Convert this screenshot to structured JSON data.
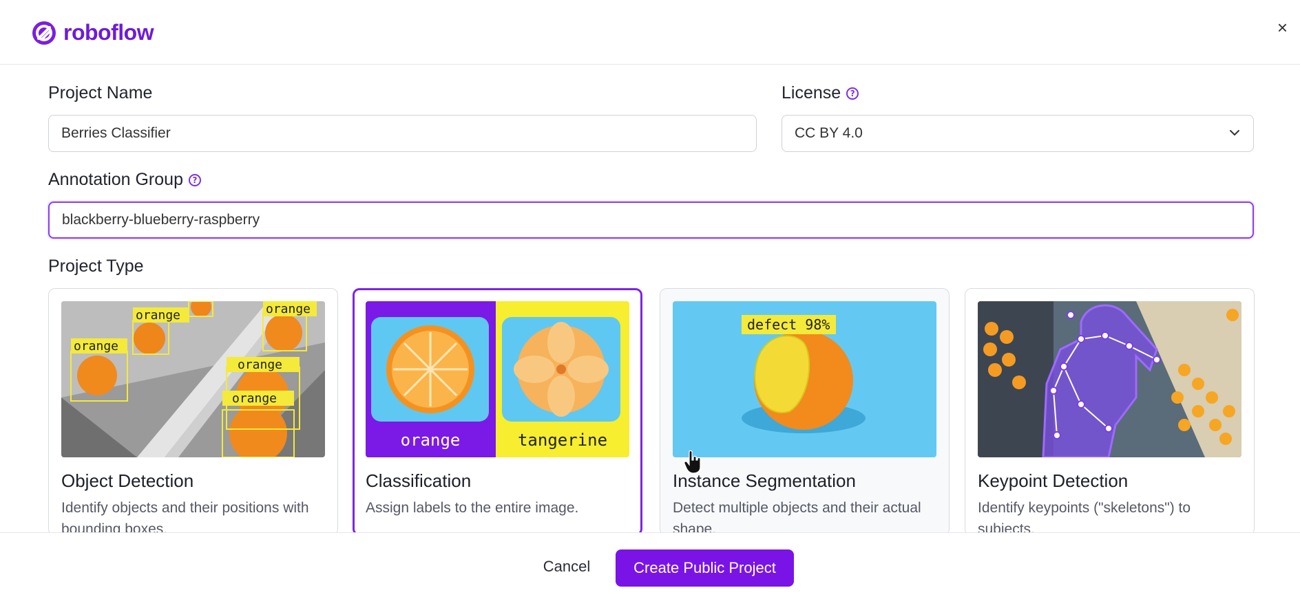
{
  "header": {
    "brand": "roboflow",
    "close_label": "×"
  },
  "form": {
    "project_name_label": "Project Name",
    "project_name_value": "Berries Classifier",
    "license_label": "License",
    "license_value": "CC BY 4.0",
    "annotation_group_label": "Annotation Group",
    "annotation_group_value": "blackberry-blueberry-raspberry",
    "project_type_label": "Project Type",
    "help_glyph": "?"
  },
  "project_types": [
    {
      "title": "Object Detection",
      "description": "Identify objects and their positions with bounding boxes.",
      "image_labels": [
        "orange",
        "orange",
        "orange",
        "orange",
        "orange"
      ],
      "selected": false
    },
    {
      "title": "Classification",
      "description": "Assign labels to the entire image.",
      "image_labels": [
        "orange",
        "tangerine"
      ],
      "selected": true
    },
    {
      "title": "Instance Segmentation",
      "description": "Detect multiple objects and their actual shape.",
      "image_labels": [
        "defect 98%"
      ],
      "selected": false
    },
    {
      "title": "Keypoint Detection",
      "description": "Identify keypoints (\"skeletons\") to subjects.",
      "selected": false
    }
  ],
  "footer": {
    "cancel_label": "Cancel",
    "create_label": "Create Public Project"
  },
  "colors": {
    "brand": "#6e1bd8",
    "primary_button": "#7a14e6",
    "focus_border": "#8a3df0"
  }
}
